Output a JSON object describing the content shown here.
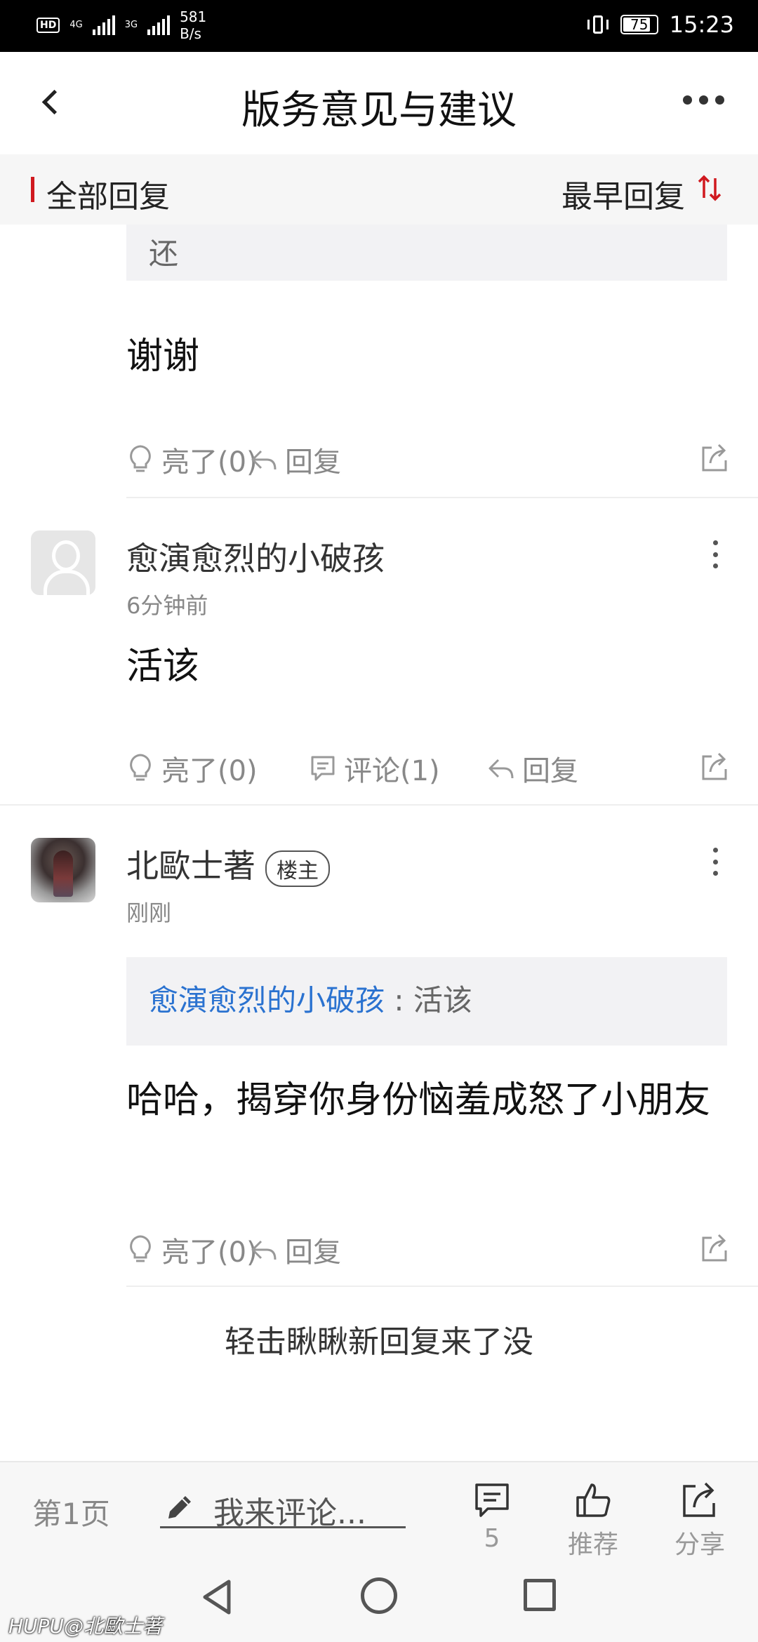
{
  "status_bar": {
    "hd": "HD",
    "net1": "4G",
    "net2": "3G",
    "speed_value": "581",
    "speed_unit": "B/s",
    "battery": "75",
    "time": "15:23"
  },
  "header": {
    "title": "版务意见与建议"
  },
  "tabs": {
    "all_label": "全部回复",
    "sort_label": "最早回复"
  },
  "post1": {
    "quote_line": "还",
    "body": "谢谢",
    "light": "亮了(0)",
    "reply": "回复"
  },
  "post2": {
    "username": "愈演愈烈的小破孩",
    "time": "6分钟前",
    "body": "活该",
    "light": "亮了(0)",
    "comment": "评论(1)",
    "reply": "回复"
  },
  "post3": {
    "username": "北歐士著",
    "badge": "楼主",
    "time": "刚刚",
    "quote_user": "愈演愈烈的小破孩",
    "quote_text": " : 活该",
    "body": "哈哈，揭穿你身份恼羞成怒了小朋友",
    "light": "亮了(0)",
    "reply": "回复"
  },
  "load_more": "轻击瞅瞅新回复来了没",
  "bottom_bar": {
    "page": "第1页",
    "comment_placeholder": "我来评论...",
    "comments_count": "5",
    "recommend": "推荐",
    "share": "分享"
  },
  "watermark": {
    "brand": "HUPU",
    "user": "@北歐士著"
  },
  "colors": {
    "accent_red": "#d0191f",
    "link_blue": "#2a72d0"
  }
}
